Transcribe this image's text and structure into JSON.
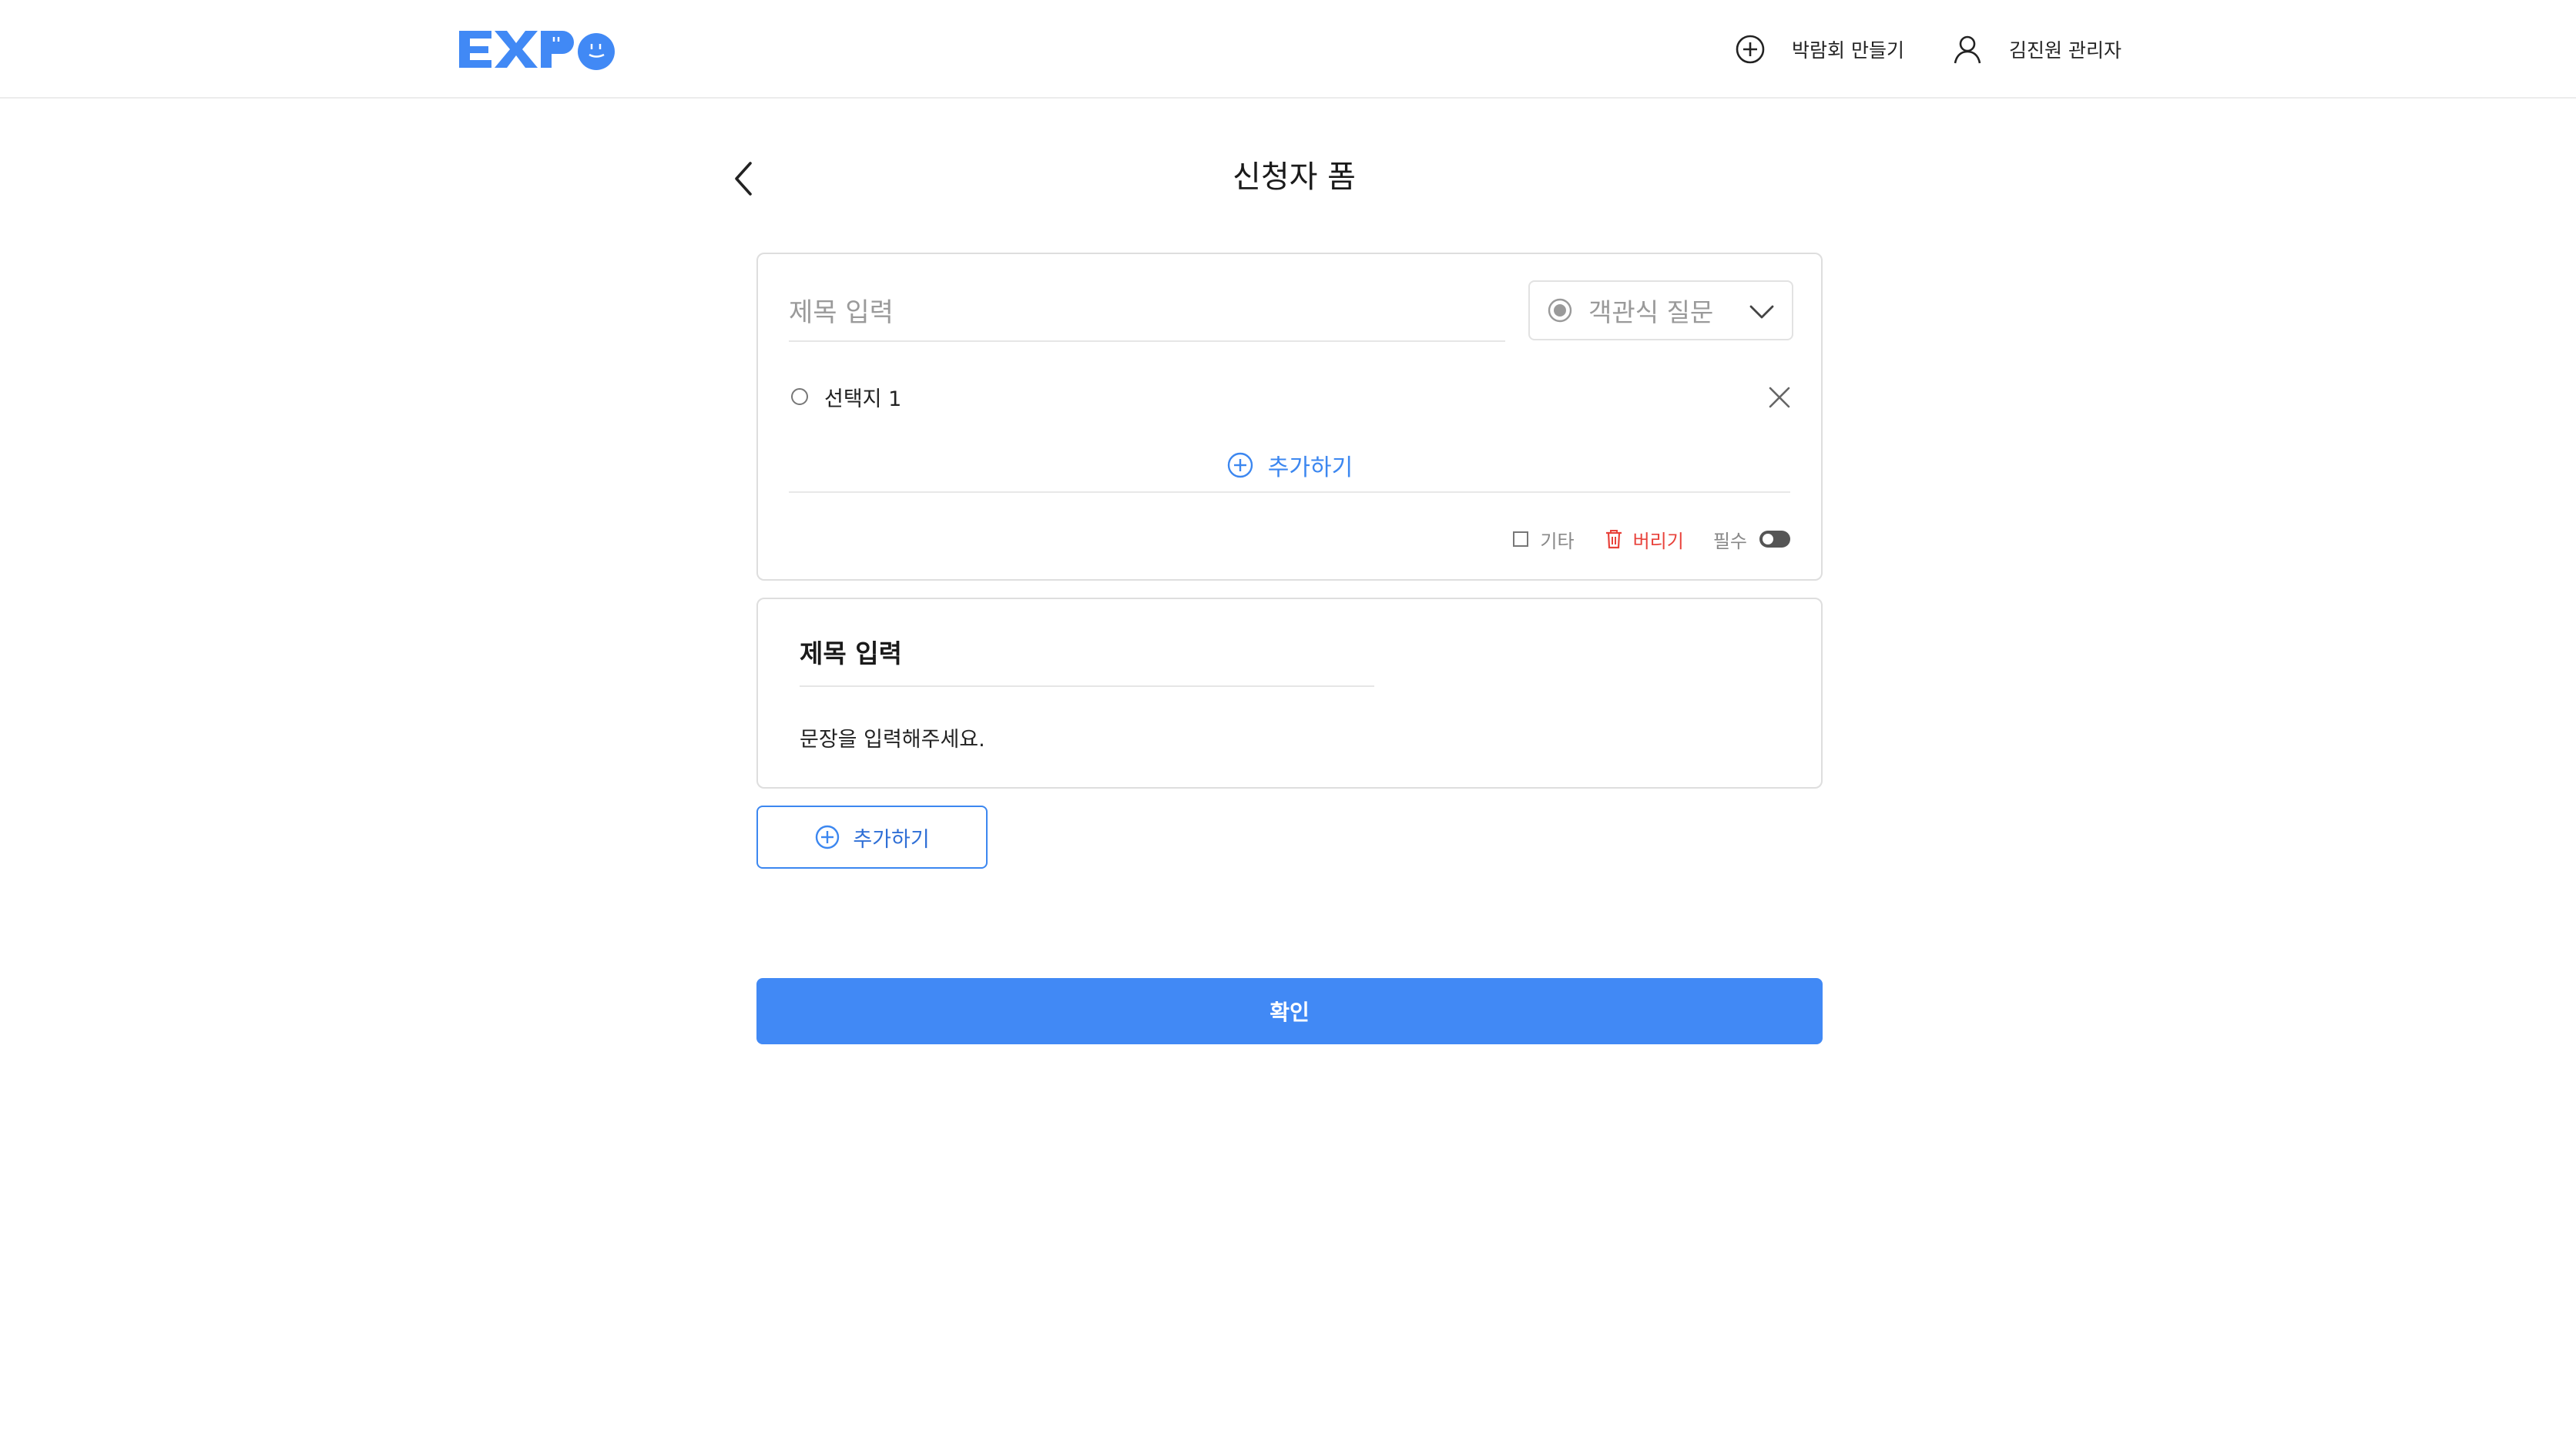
{
  "header": {
    "logo_text": "EXPO",
    "create_label": "박람회 만들기",
    "user_label": "김진원 관리자"
  },
  "page": {
    "title": "신청자 폼"
  },
  "questions": [
    {
      "title_placeholder": "제목 입력",
      "type_label": "객관식 질문",
      "options": [
        {
          "label": "선택지 1"
        }
      ],
      "add_option_label": "추가하기",
      "etc_label": "기타",
      "discard_label": "버리기",
      "required_label": "필수",
      "required": false
    },
    {
      "title": "제목 입력",
      "body": "문장을 입력해주세요."
    }
  ],
  "add_question_label": "추가하기",
  "confirm_label": "확인",
  "colors": {
    "brand": "#4189f5",
    "accent_text": "#3c87f0",
    "danger": "#e8423b"
  }
}
